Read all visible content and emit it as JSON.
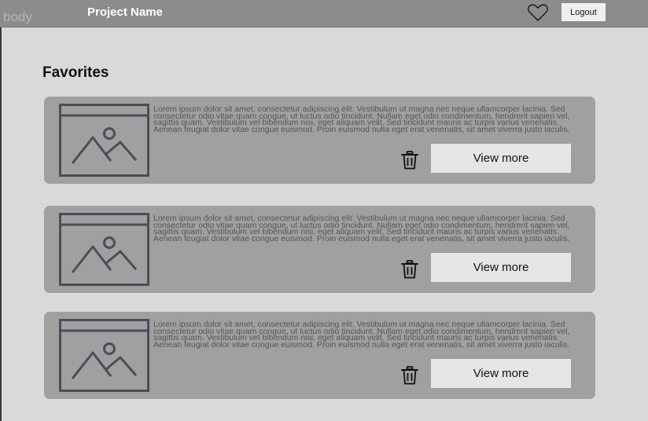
{
  "header": {
    "frame_label": "body",
    "project_name": "Project Name",
    "favorites_icon": "heart-icon",
    "logout_label": "Logout"
  },
  "main": {
    "title": "Favorites",
    "cards": [
      {
        "thumbnail_icon": "image-placeholder-icon",
        "description": "Lorem ipsum dolor sit amet, consectetur adipiscing elit. Vestibulum ut magna nec neque ullamcorper lacinia. Sed consectetur odio vitae quam congue, ut luctus odio tincidunt. Nullam eget odio condimentum, hendrerit sapien vel, sagittis quam. Vestibulum vel bibendum nisi, eget aliquam velit. Sed tincidunt mauris ac turpis varius venenatis. Aenean feugiat dolor vitae congue euismod. Proin euismod nulla eget erat venenatis, sit amet viverra justo iaculis.",
        "delete_icon": "trash-icon",
        "button_label": "View more"
      },
      {
        "thumbnail_icon": "image-placeholder-icon",
        "description": "Lorem ipsum dolor sit amet, consectetur adipiscing elit. Vestibulum ut magna nec neque ullamcorper lacinia. Sed consectetur odio vitae quam congue, ut luctus odio tincidunt. Nullam eget odio condimentum, hendrerit sapien vel, sagittis quam. Vestibulum vel bibendum nisi, eget aliquam velit. Sed tincidunt mauris ac turpis varius venenatis. Aenean feugiat dolor vitae congue euismod. Proin euismod nulla eget erat venenatis, sit amet viverra justo iaculis.",
        "delete_icon": "trash-icon",
        "button_label": "View more"
      },
      {
        "thumbnail_icon": "image-placeholder-icon",
        "description": "Lorem ipsum dolor sit amet, consectetur adipiscing elit. Vestibulum ut magna nec neque ullamcorper lacinia. Sed consectetur odio vitae quam congue, ut luctus odio tincidunt. Nullam eget odio condimentum, hendrerit sapien vel, sagittis quam. Vestibulum vel bibendum nisi, eget aliquam velit. Sed tincidunt mauris ac turpis varius venenatis. Aenean feugiat dolor vitae congue euismod. Proin euismod nulla eget erat venenatis, sit amet viverra justo iaculis.",
        "delete_icon": "trash-icon",
        "button_label": "View more"
      }
    ]
  },
  "colors": {
    "background": "#d9d9d9",
    "header": "#8c8c8c",
    "card": "#a0a0a0",
    "button": "#e6e6e6",
    "icon_stroke": "#4a4e5a"
  }
}
